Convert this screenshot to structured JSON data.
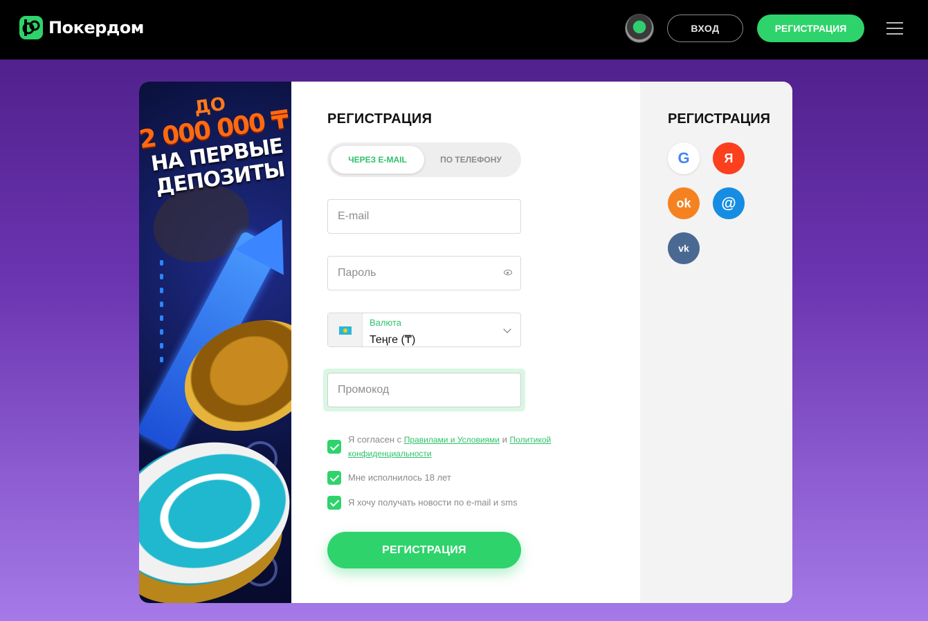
{
  "header": {
    "logo_text": "Покердом",
    "login_label": "ВХОД",
    "register_label": "РЕГИСТРАЦИЯ"
  },
  "promo": {
    "upto": "ДО",
    "amount": "2 000 000 ₸",
    "line1": "НА ПЕРВЫЕ",
    "line2": "ДЕПОЗИТЫ"
  },
  "form": {
    "title": "РЕГИСТРАЦИЯ",
    "tabs": [
      {
        "label": "ЧЕРЕЗ E-MAIL",
        "active": true
      },
      {
        "label": "ПО ТЕЛЕФОНУ",
        "active": false
      }
    ],
    "email": {
      "placeholder": "E-mail",
      "value": ""
    },
    "password": {
      "placeholder": "Пароль",
      "value": ""
    },
    "currency": {
      "label": "Валюта",
      "value": "Теңге (₸)",
      "flag": "kazakhstan-flag"
    },
    "promocode": {
      "placeholder": "Промокод",
      "value": ""
    },
    "checkboxes": [
      {
        "checked": true,
        "text_before": "Я согласен с",
        "link1": "Правилами и Условиями",
        "text_mid": "и",
        "link2": "Политикой конфиденциальности"
      },
      {
        "checked": true,
        "text": "Мне исполнилось 18 лет"
      },
      {
        "checked": true,
        "text": "Я хочу получать новости по e-mail и sms"
      }
    ],
    "submit_label": "РЕГИСТРАЦИЯ"
  },
  "social": {
    "title": "РЕГИСТРАЦИЯ",
    "providers": [
      {
        "name": "google",
        "glyph": "G",
        "color": "#ffffff"
      },
      {
        "name": "yandex",
        "glyph": "Я",
        "color": "#fc3f1d"
      },
      {
        "name": "odnoklassniki",
        "glyph": "ok",
        "color": "#f58220"
      },
      {
        "name": "mail-ru",
        "glyph": "@",
        "color": "#168de2"
      },
      {
        "name": "vk",
        "glyph": "vk",
        "color": "#4a6992"
      }
    ]
  },
  "colors": {
    "accent": "#2fd36b",
    "header_bg": "#000000",
    "bg_top": "#4a1c84",
    "bg_bottom": "#a57ae8"
  }
}
